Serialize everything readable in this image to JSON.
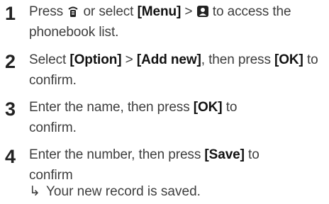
{
  "steps": [
    {
      "number": "1",
      "pre": "Press",
      "phonebook_icon": "phonebook-key-icon",
      "mid": "or select",
      "menu": "[Menu]",
      "gt": ">",
      "contacts_icon": "contacts-icon",
      "post": "to access the phonebook list."
    },
    {
      "number": "2",
      "pre": "Select",
      "option": "[Option]",
      "gt": ">",
      "add_new": "[Add new]",
      "mid": ", then press",
      "ok": "[OK]",
      "post": "to confirm."
    },
    {
      "number": "3",
      "pre": "Enter the name, then press",
      "ok": "[OK]",
      "post": "to confirm."
    },
    {
      "number": "4",
      "pre": "Enter the number, then press",
      "save": "[Save]",
      "post": "to confirm"
    }
  ],
  "result": {
    "arrow": "↳",
    "text": "Your new record is saved."
  }
}
